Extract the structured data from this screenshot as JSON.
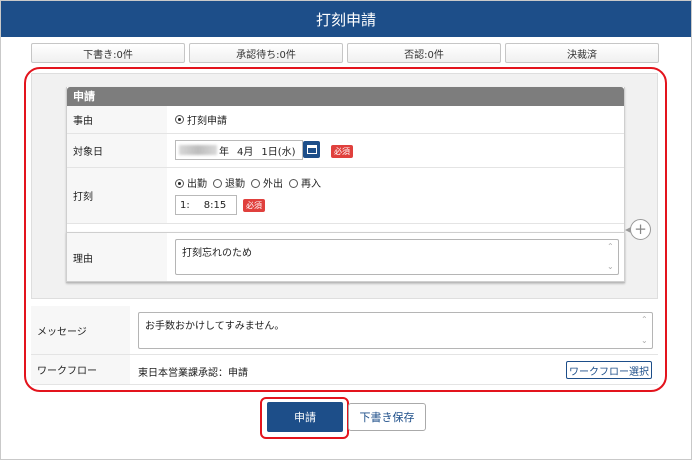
{
  "title": "打刻申請",
  "status_tabs": [
    "下書き:0件",
    "承認待ち:0件",
    "否認:0件",
    "決裁済"
  ],
  "card": {
    "header": "申請",
    "reason_type": {
      "label": "事由",
      "option": "打刻申請"
    },
    "target_date": {
      "label": "対象日",
      "year_suffix": "年",
      "month": "4月",
      "day": "1日(水)",
      "required": "必須"
    },
    "punch": {
      "label": "打刻",
      "options": [
        "出勤",
        "退勤",
        "外出",
        "再入"
      ],
      "selected": "出勤",
      "hour_prefix": "1:",
      "time": "8:15",
      "required": "必須"
    },
    "reason": {
      "label": "理由",
      "value": "打刻忘れのため"
    }
  },
  "message": {
    "label": "メッセージ",
    "value": "お手数おかけしてすみません。"
  },
  "workflow": {
    "label": "ワークフロー",
    "value": "東日本営業課承認：申請",
    "select_button": "ワークフロー選択"
  },
  "buttons": {
    "submit": "申請",
    "save_draft": "下書き保存"
  },
  "colors": {
    "primary": "#1d4e89",
    "highlight": "#e3141d",
    "required": "#e0403d"
  }
}
